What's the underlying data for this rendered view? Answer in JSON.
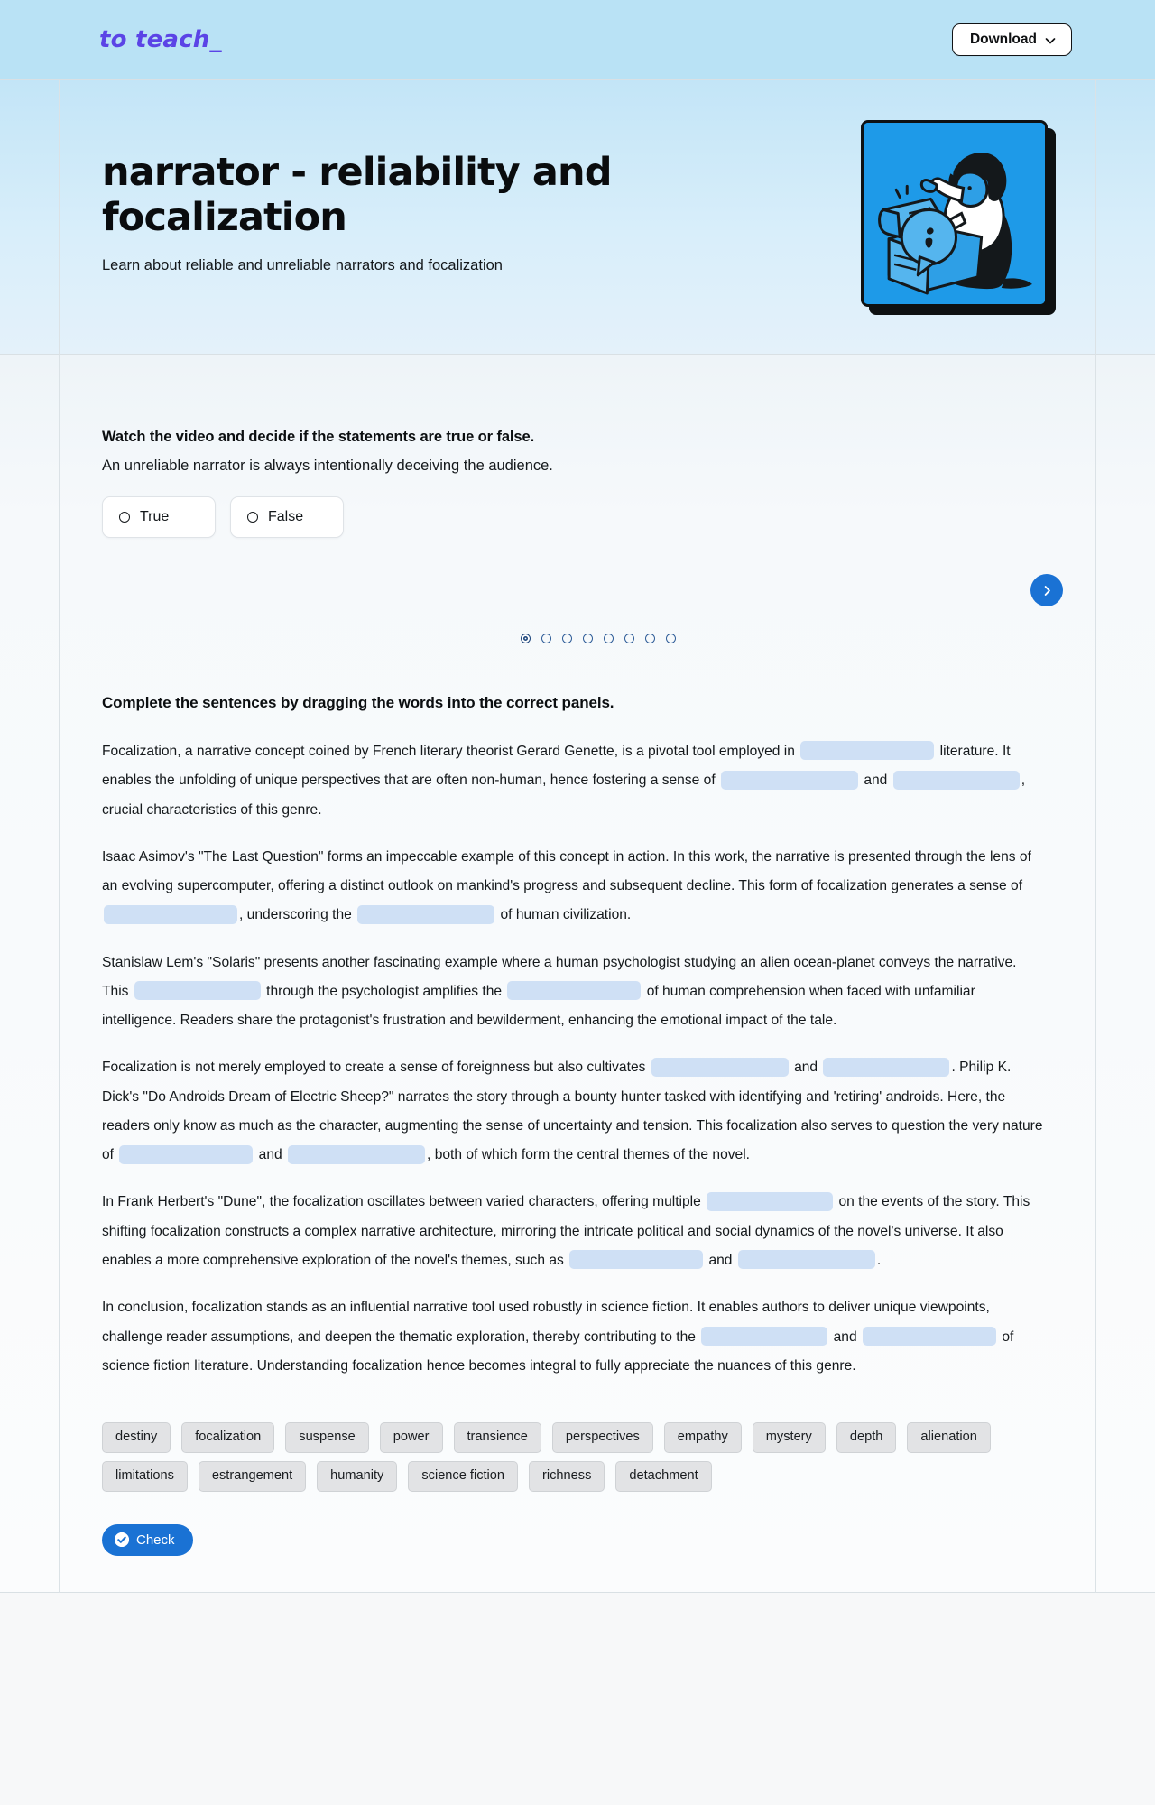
{
  "topbar": {
    "brand": "to teach_",
    "download_label": "Download",
    "download_icon": "chevron-down-icon"
  },
  "hero": {
    "title": "narrator - reliability and focalization",
    "subtitle": "Learn about reliable and unreliable narrators and focalization",
    "illustration_alt": "person kneeling and opening a box with a speech bubble"
  },
  "exercise_truefalse": {
    "instruction": "Watch the video and decide if the statements are true or false.",
    "statement": "An unreliable narrator is always intentionally deceiving the audience.",
    "options": [
      {
        "label": "True"
      },
      {
        "label": "False"
      }
    ],
    "next_icon": "chevron-right-icon",
    "pager": {
      "total": 8,
      "active_index": 0
    }
  },
  "exercise_dragdrop": {
    "instruction": "Complete the sentences by dragging the words into the correct panels.",
    "paragraphs": [
      {
        "segments": [
          {
            "type": "text",
            "value": "Focalization, a narrative concept coined by French literary theorist Gerard Genette, is a pivotal tool employed in "
          },
          {
            "type": "blank"
          },
          {
            "type": "text",
            "value": " literature. It enables the unfolding of unique perspectives that are often non-human, hence fostering a sense of "
          },
          {
            "type": "blank"
          },
          {
            "type": "text",
            "value": " and "
          },
          {
            "type": "blank"
          },
          {
            "type": "text",
            "value": ", crucial characteristics of this genre."
          }
        ]
      },
      {
        "segments": [
          {
            "type": "text",
            "value": "Isaac Asimov's \"The Last Question\" forms an impeccable example of this concept in action. In this work, the narrative is presented through the lens of an evolving supercomputer, offering a distinct outlook on mankind's progress and subsequent decline. This form of focalization generates a sense of "
          },
          {
            "type": "blank"
          },
          {
            "type": "text",
            "value": ", underscoring the "
          },
          {
            "type": "blank"
          },
          {
            "type": "text",
            "value": " of human civilization."
          }
        ]
      },
      {
        "segments": [
          {
            "type": "text",
            "value": "Stanislaw Lem's \"Solaris\" presents another fascinating example where a human psychologist studying an alien ocean-planet conveys the narrative. This "
          },
          {
            "type": "blank"
          },
          {
            "type": "text",
            "value": " through the psychologist amplifies the "
          },
          {
            "type": "blank"
          },
          {
            "type": "text",
            "value": " of human comprehension when faced with unfamiliar intelligence. Readers share the protagonist's frustration and bewilderment, enhancing the emotional impact of the tale."
          }
        ]
      },
      {
        "segments": [
          {
            "type": "text",
            "value": "Focalization is not merely employed to create a sense of foreignness but also cultivates "
          },
          {
            "type": "blank"
          },
          {
            "type": "text",
            "value": " and "
          },
          {
            "type": "blank"
          },
          {
            "type": "text",
            "value": ". Philip K. Dick's \"Do Androids Dream of Electric Sheep?\" narrates the story through a bounty hunter tasked with identifying and 'retiring' androids. Here, the readers only know as much as the character, augmenting the sense of uncertainty and tension. This focalization also serves to question the very nature of "
          },
          {
            "type": "blank"
          },
          {
            "type": "text",
            "value": " and "
          },
          {
            "type": "blank"
          },
          {
            "type": "text",
            "value": ", both of which form the central themes of the novel."
          }
        ]
      },
      {
        "segments": [
          {
            "type": "text",
            "value": "In Frank Herbert's \"Dune\", the focalization oscillates between varied characters, offering multiple "
          },
          {
            "type": "blank"
          },
          {
            "type": "text",
            "value": " on the events of the story. This shifting focalization constructs a complex narrative architecture, mirroring the intricate political and social dynamics of the novel's universe. It also enables a more comprehensive exploration of the novel's themes, such as "
          },
          {
            "type": "blank"
          },
          {
            "type": "text",
            "value": " and "
          },
          {
            "type": "blank"
          },
          {
            "type": "text",
            "value": "."
          }
        ]
      },
      {
        "segments": [
          {
            "type": "text",
            "value": "In conclusion, focalization stands as an influential narrative tool used robustly in science fiction. It enables authors to deliver unique viewpoints, challenge reader assumptions, and deepen the thematic exploration, thereby contributing to the "
          },
          {
            "type": "blank"
          },
          {
            "type": "text",
            "value": " and "
          },
          {
            "type": "blank"
          },
          {
            "type": "text",
            "value": " of science fiction literature. Understanding focalization hence becomes integral to fully appreciate the nuances of this genre."
          }
        ]
      }
    ],
    "word_bank": [
      "destiny",
      "focalization",
      "suspense",
      "power",
      "transience",
      "perspectives",
      "empathy",
      "mystery",
      "depth",
      "alienation",
      "limitations",
      "estrangement",
      "humanity",
      "science fiction",
      "richness",
      "detachment"
    ],
    "check_label": "Check",
    "check_icon": "check-circle-icon"
  },
  "colors": {
    "brand_purple": "#5b44e6",
    "hero_blue": "#c3e5f7",
    "accent_blue": "#1a72d4",
    "blank_fill": "#cfe0f5",
    "chip_bg": "#e2e3e5",
    "illustration_blue": "#1e9ae8"
  }
}
